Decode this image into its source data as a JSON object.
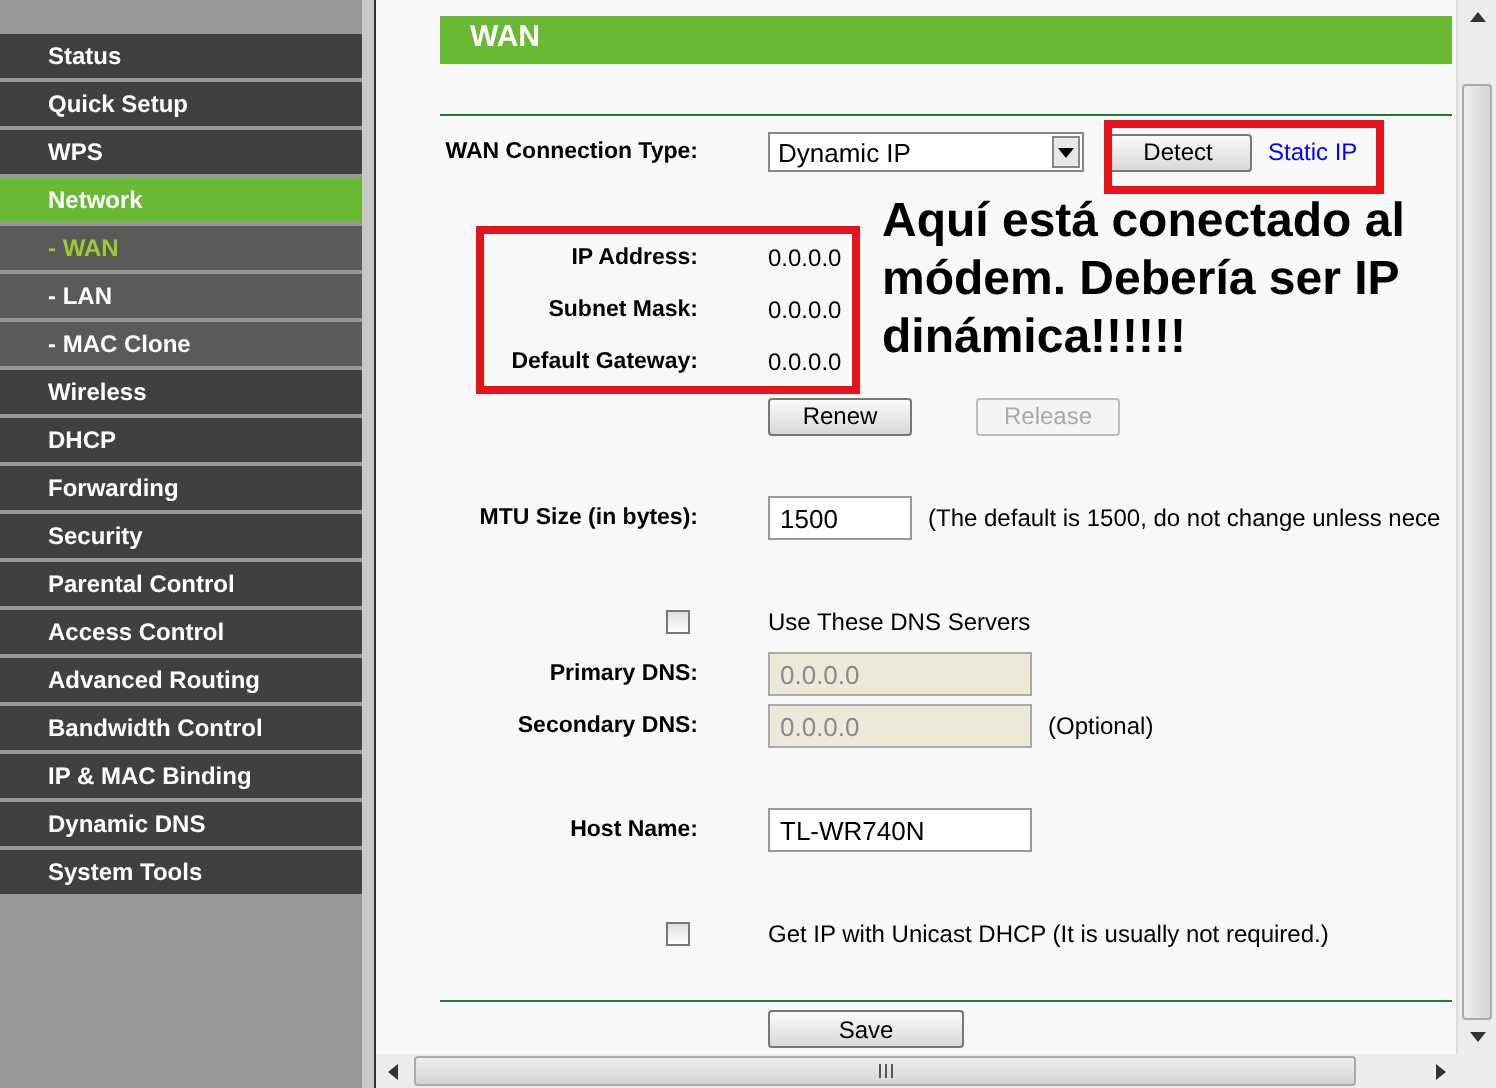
{
  "sidebar": {
    "items": [
      {
        "label": "Status",
        "kind": "section",
        "selected": false
      },
      {
        "label": "Quick Setup",
        "kind": "section",
        "selected": false
      },
      {
        "label": "WPS",
        "kind": "section",
        "selected": false
      },
      {
        "label": "Network",
        "kind": "section",
        "selected": true
      },
      {
        "label": "- WAN",
        "kind": "sub",
        "selected": true
      },
      {
        "label": "- LAN",
        "kind": "sub",
        "selected": false
      },
      {
        "label": "- MAC Clone",
        "kind": "sub",
        "selected": false
      },
      {
        "label": "Wireless",
        "kind": "section",
        "selected": false
      },
      {
        "label": "DHCP",
        "kind": "section",
        "selected": false
      },
      {
        "label": "Forwarding",
        "kind": "section",
        "selected": false
      },
      {
        "label": "Security",
        "kind": "section",
        "selected": false
      },
      {
        "label": "Parental Control",
        "kind": "section",
        "selected": false
      },
      {
        "label": "Access Control",
        "kind": "section",
        "selected": false
      },
      {
        "label": "Advanced Routing",
        "kind": "section",
        "selected": false
      },
      {
        "label": "Bandwidth Control",
        "kind": "section",
        "selected": false
      },
      {
        "label": "IP & MAC Binding",
        "kind": "section",
        "selected": false
      },
      {
        "label": "Dynamic DNS",
        "kind": "section",
        "selected": false
      },
      {
        "label": "System Tools",
        "kind": "section",
        "selected": false
      }
    ]
  },
  "page_title": "WAN",
  "form": {
    "connection_type": {
      "label": "WAN Connection Type:",
      "value": "Dynamic IP"
    },
    "detect_button": {
      "label": "Detect",
      "disabled": false
    },
    "static_ip_link": "Static IP",
    "status": [
      {
        "label": "IP Address:",
        "value": "0.0.0.0"
      },
      {
        "label": "Subnet Mask:",
        "value": "0.0.0.0"
      },
      {
        "label": "Default Gateway:",
        "value": "0.0.0.0"
      }
    ],
    "renew_button": {
      "label": "Renew",
      "disabled": false
    },
    "release_button": {
      "label": "Release",
      "disabled": true
    },
    "mtu": {
      "label": "MTU Size (in bytes):",
      "value": "1500",
      "note": "(The default is 1500, do not change unless nece"
    },
    "use_dns": {
      "label": "Use These DNS Servers",
      "checked": false
    },
    "primary_dns": {
      "label": "Primary DNS:",
      "value": "0.0.0.0",
      "disabled": true
    },
    "secondary_dns": {
      "label": "Secondary DNS:",
      "value": "0.0.0.0",
      "disabled": true,
      "note": "(Optional)"
    },
    "host_name": {
      "label": "Host Name:",
      "value": "TL-WR740N"
    },
    "unicast": {
      "label": "Get IP with Unicast DHCP (It is usually not required.)",
      "checked": false
    },
    "save_button": {
      "label": "Save",
      "disabled": false
    }
  },
  "annotation": {
    "text": "Aquí está conectado al módem. Debería ser IP dinámica!!!!!!"
  }
}
